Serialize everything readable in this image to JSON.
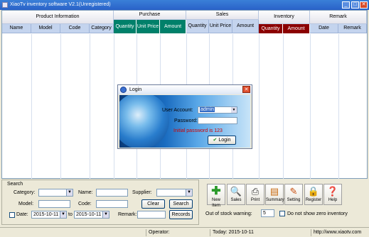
{
  "window": {
    "title": "XiaoTv inventory software V2.1(Unregistered)",
    "min_symbol": "_",
    "max_symbol": "□",
    "close_symbol": "✕"
  },
  "grid": {
    "groups": {
      "product_info": "Product   Information",
      "purchase": "Purchase",
      "sales": "Sales",
      "inventory": "Inventory",
      "remark": "Remark"
    },
    "columns": {
      "name": "Name",
      "model": "Model",
      "code": "Code",
      "category": "Category",
      "purchase_quantity": "Quantity",
      "purchase_unit_price": "Unit Price",
      "purchase_amount": "Amount",
      "sales_quantity": "Quantity",
      "sales_unit_price": "Unit Price",
      "sales_amount": "Amount",
      "inventory_quantity": "Quantity",
      "inventory_amount": "Amount",
      "remark_date": "Date",
      "remark_remark": "Remark"
    },
    "colors": {
      "purchase_header": "#00806a",
      "inventory_header": "#8b0000"
    }
  },
  "search": {
    "legend": "Search",
    "category_label": "Category:",
    "name_label": "Name:",
    "supplier_label": "Supplier:",
    "model_label": "Model:",
    "code_label": "Code:",
    "date_label": "Date:",
    "date_from": "2015-10-11",
    "to_label": "to",
    "date_to": "2015-10-11",
    "remark_label": "Remark:",
    "clear_button": "Clear",
    "search_button": "Search",
    "records_button": "Records"
  },
  "toolbar": {
    "items": [
      {
        "label": "New Item",
        "icon": "plus-icon"
      },
      {
        "label": "Sales",
        "icon": "magnifier-icon"
      },
      {
        "label": "Print",
        "icon": "printer-icon"
      },
      {
        "label": "Summary",
        "icon": "summary-icon"
      },
      {
        "label": "Setting",
        "icon": "setting-icon"
      },
      {
        "label": "Register",
        "icon": "lock-icon"
      },
      {
        "label": "Help",
        "icon": "help-icon"
      }
    ],
    "out_of_stock_label": "Out of stock warning:",
    "out_of_stock_value": "5",
    "zero_inventory_label": "Do not show zero inventory"
  },
  "status": {
    "operator_label": "Operator:",
    "today_label": "Today: 2015-10-11",
    "url": "http://www.xiaotv.com"
  },
  "login": {
    "title": "Login",
    "user_account_label": "User Account:",
    "user_account_value": "admin",
    "password_label": "Password:",
    "hint": "Initial password is 123",
    "login_button": "Login",
    "close_symbol": "✕"
  }
}
